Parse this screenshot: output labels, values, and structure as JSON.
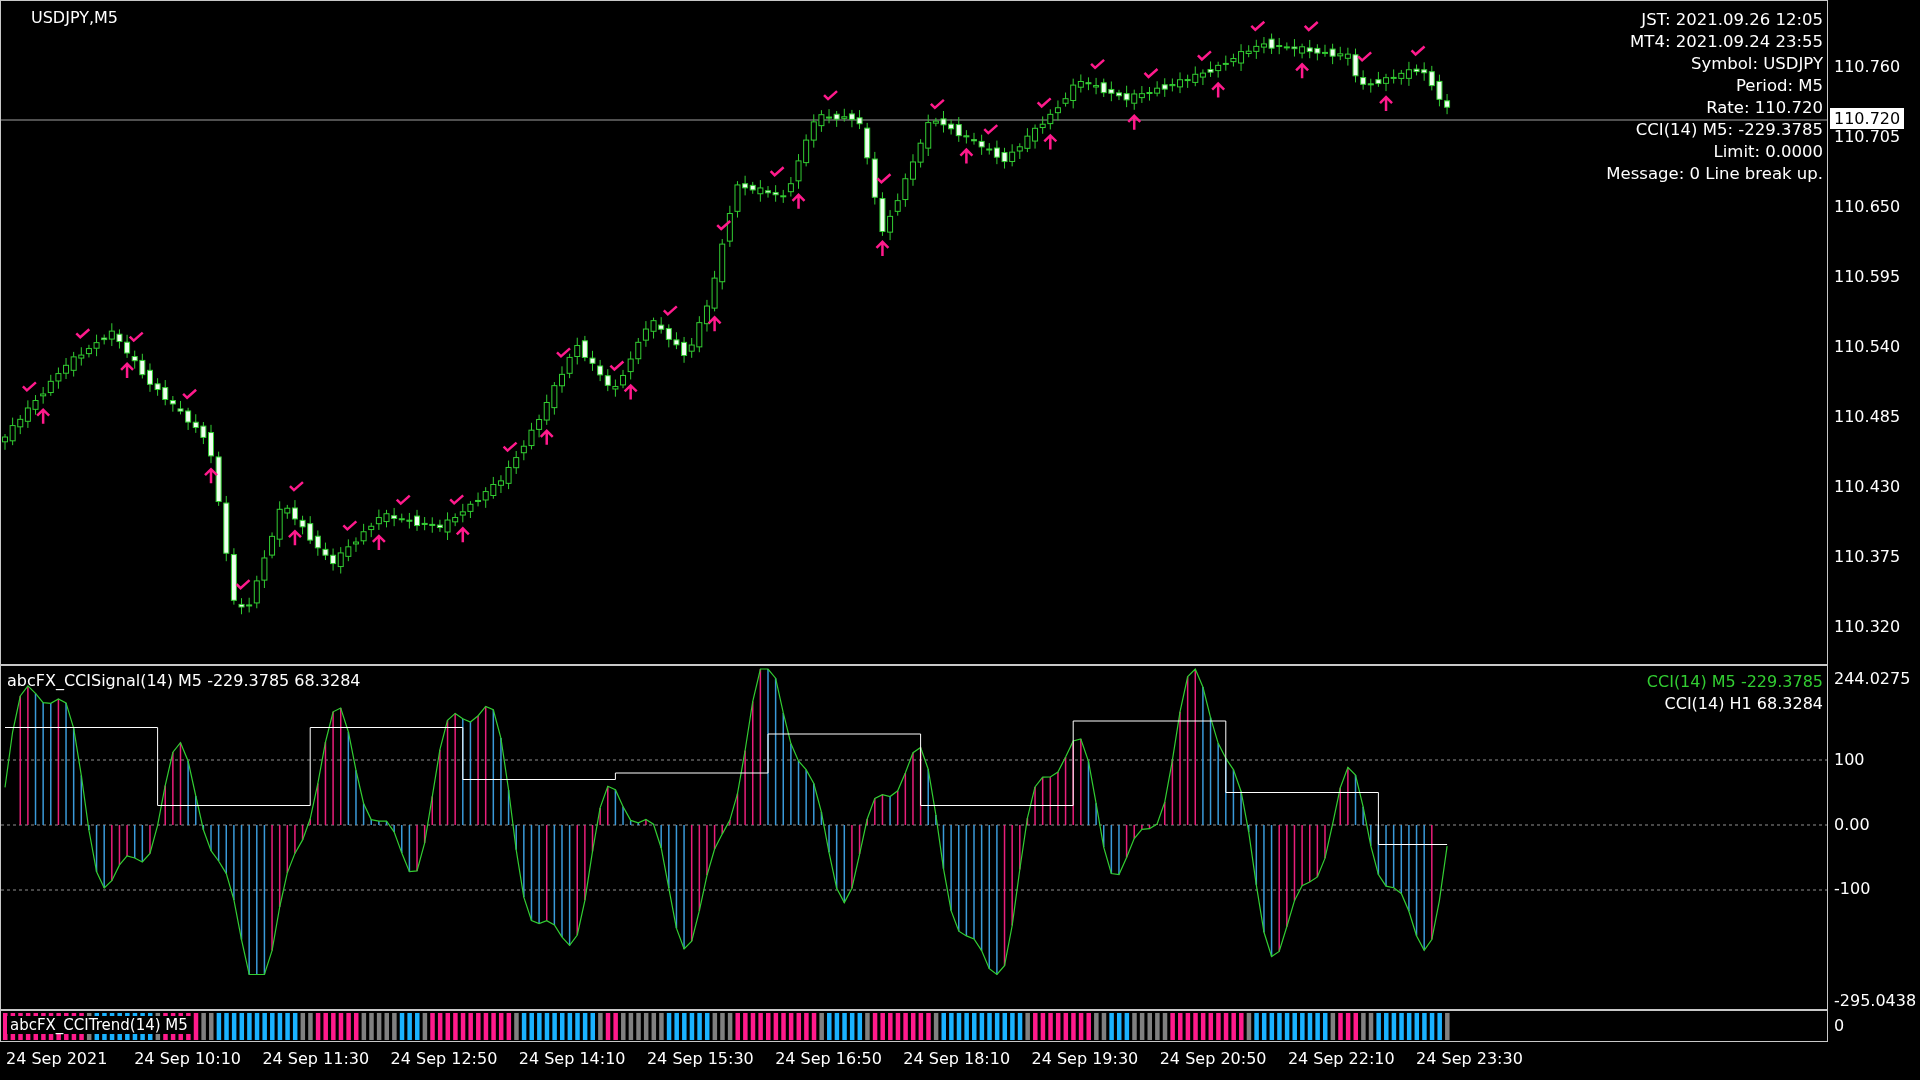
{
  "main_chart": {
    "title": "USDJPY,M5",
    "info_lines": [
      "JST: 2021.09.26 12:05",
      "MT4: 2021.09.24 23:55",
      "Symbol: USDJPY",
      "Period: M5",
      "Rate: 110.720",
      "CCI(14) M5: -229.3785",
      "Limit: 0.0000",
      "Message: 0 Line break up."
    ],
    "price_axis": [
      "110.760",
      "110.705",
      "110.650",
      "110.595",
      "110.540",
      "110.485",
      "110.430",
      "110.375",
      "110.320"
    ],
    "current_price": "110.720"
  },
  "cci_pane": {
    "label": "abcFX_CCISignal(14) M5 -229.3785 68.3284",
    "legend": [
      {
        "text": "CCI(14) M5 -229.3785",
        "color": "#32cd32"
      },
      {
        "text": "CCI(14) H1 68.3284",
        "color": "#ffffff"
      }
    ],
    "axis": [
      "244.0275",
      "100",
      "0.00",
      "-100",
      "-295.0438"
    ]
  },
  "trend_pane": {
    "label": "abcFX_CCITrend(14) M5",
    "axis_label": "0"
  },
  "time_axis": [
    "24 Sep 2021",
    "24 Sep 10:10",
    "24 Sep 11:30",
    "24 Sep 12:50",
    "24 Sep 14:10",
    "24 Sep 15:30",
    "24 Sep 16:50",
    "24 Sep 18:10",
    "24 Sep 19:30",
    "24 Sep 20:50",
    "24 Sep 22:10",
    "24 Sep 23:30"
  ]
}
